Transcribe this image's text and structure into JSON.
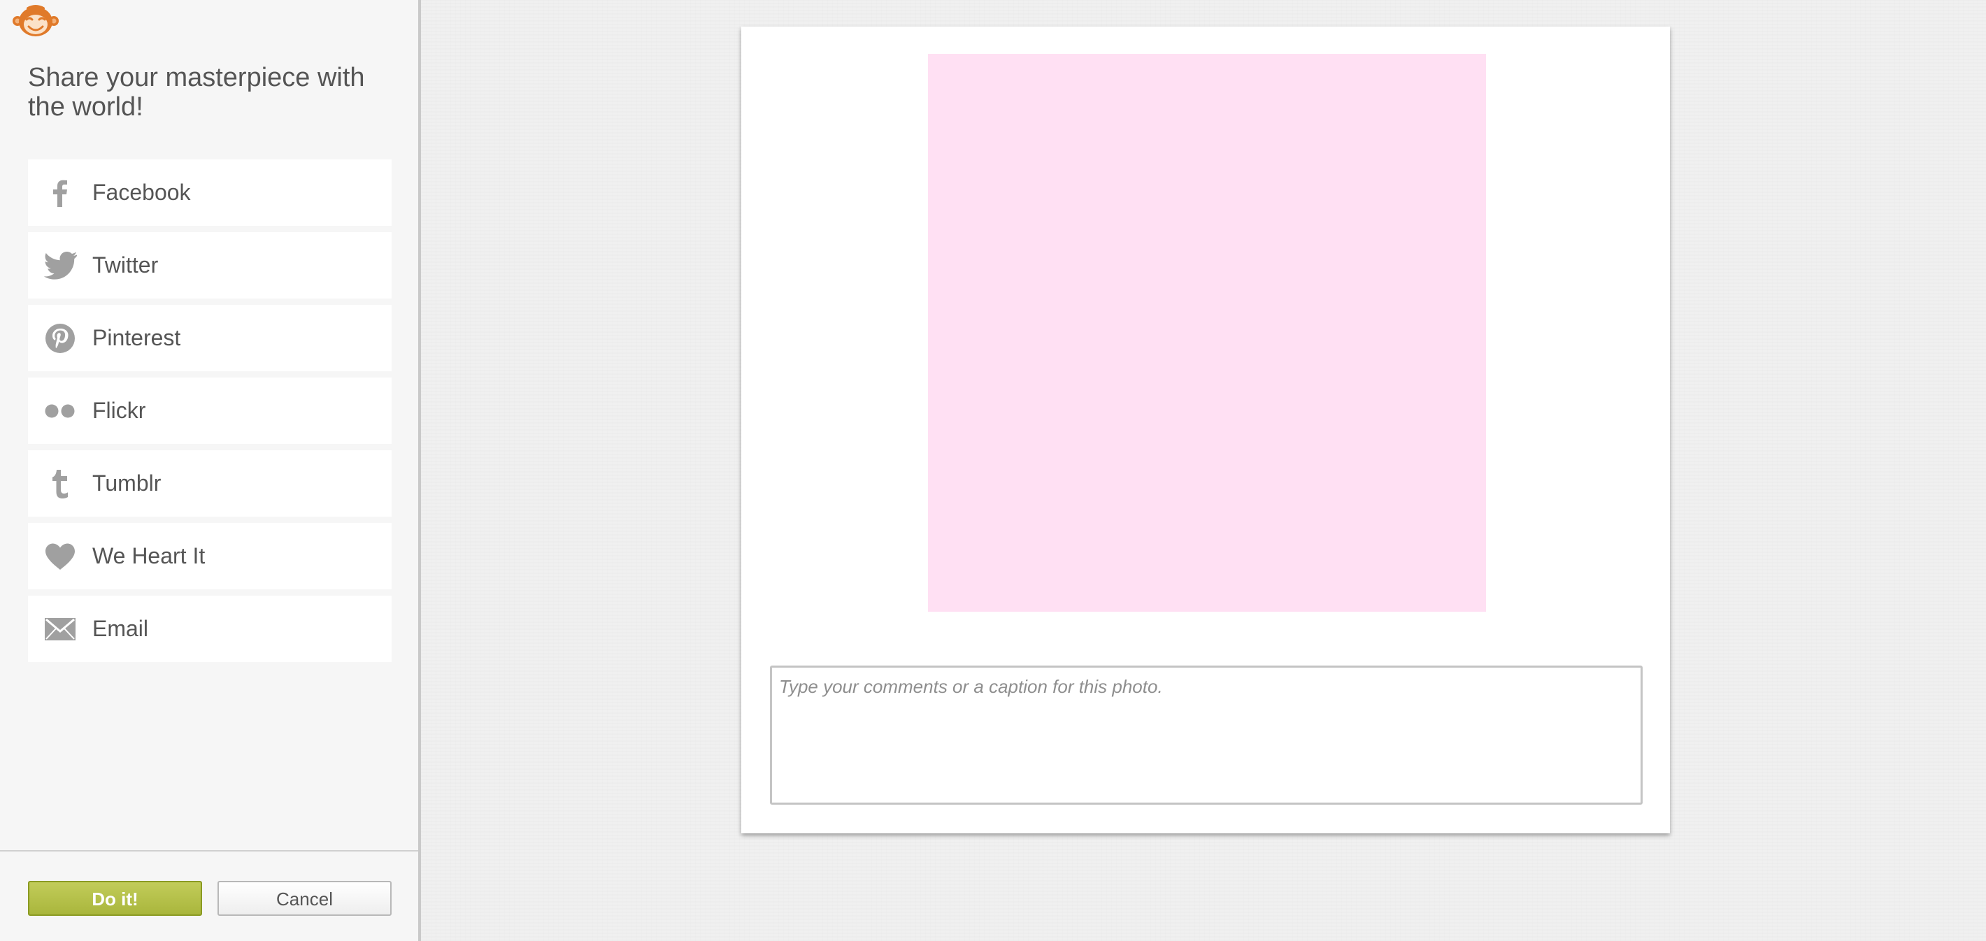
{
  "sidebar": {
    "logo_icon": "monkey-logo-icon",
    "title": "Share your masterpiece with the world!",
    "share_items": [
      {
        "label": "Facebook",
        "icon": "facebook-icon"
      },
      {
        "label": "Twitter",
        "icon": "twitter-icon"
      },
      {
        "label": "Pinterest",
        "icon": "pinterest-icon"
      },
      {
        "label": "Flickr",
        "icon": "flickr-icon"
      },
      {
        "label": "Tumblr",
        "icon": "tumblr-icon"
      },
      {
        "label": "We Heart It",
        "icon": "heart-icon"
      },
      {
        "label": "Email",
        "icon": "envelope-icon"
      }
    ],
    "primary_button": "Do it!",
    "cancel_button": "Cancel"
  },
  "preview": {
    "photo_color": "#ffe0f3",
    "caption_placeholder": "Type your comments or a caption for this photo.",
    "caption_value": ""
  },
  "colors": {
    "accent_green": "#a9b63c",
    "logo_orange": "#e07a2a",
    "icon_gray": "#a0a0a0"
  }
}
